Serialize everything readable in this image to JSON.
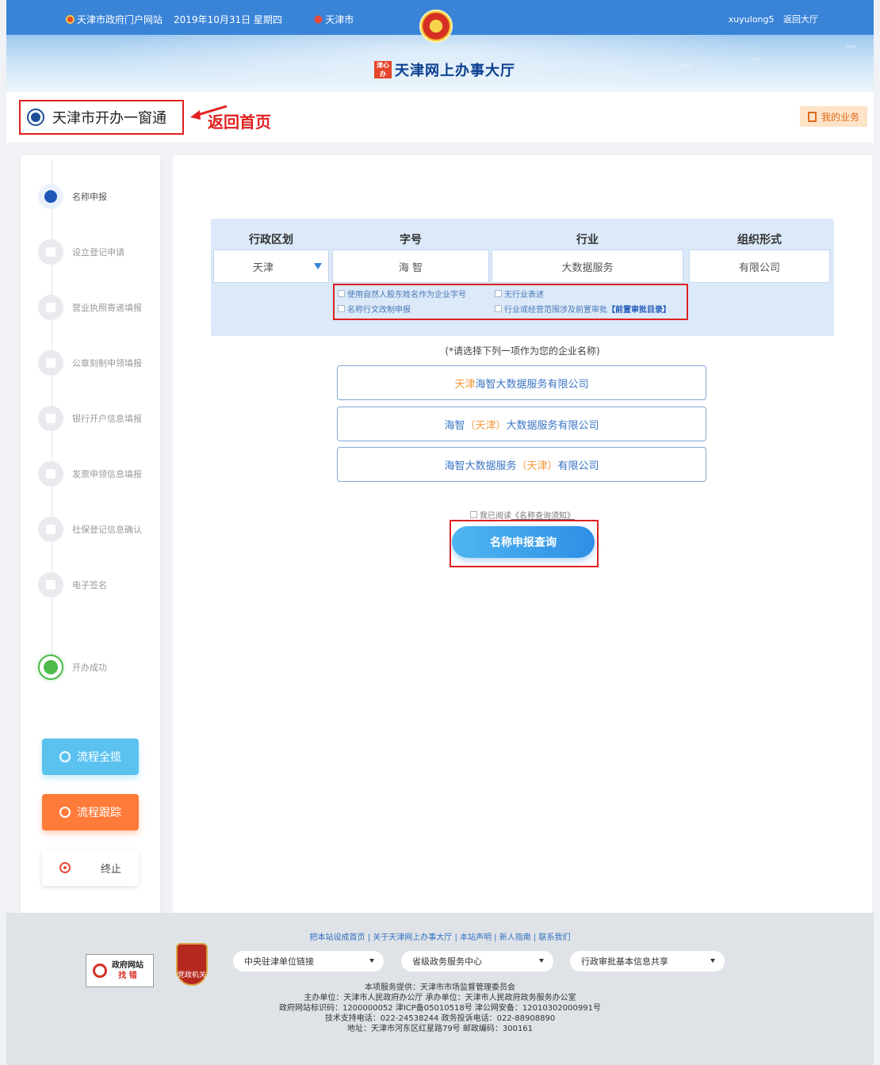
{
  "topbar": {
    "portal": "天津市政府门户网站",
    "date": "2019年10月31日 星期四",
    "city": "天津市",
    "user": "xuyulong5",
    "back_hall": "返回大厅"
  },
  "banner": {
    "logo": "津心办",
    "title": "天津网上办事大厅"
  },
  "header": {
    "service_title": "天津市开办一窗通",
    "annotation": "返回首页",
    "my_business": "我的业务"
  },
  "sidebar": {
    "steps": [
      {
        "label": "名称申报",
        "icon": "user-icon"
      },
      {
        "label": "设立登记申请",
        "icon": "building-icon"
      },
      {
        "label": "营业执照寄递填报",
        "icon": "license-icon"
      },
      {
        "label": "公章刻制申领填报",
        "icon": "stamp-icon"
      },
      {
        "label": "银行开户信息填报",
        "icon": "location-icon"
      },
      {
        "label": "发票申领信息填报",
        "icon": "invoice-icon"
      },
      {
        "label": "社保登记信息确认",
        "icon": "social-security-icon"
      },
      {
        "label": "电子签名",
        "icon": "pen-icon"
      },
      {
        "label": "开办成功",
        "icon": "check-icon"
      }
    ],
    "btn_overview": "流程全揽",
    "btn_tracking": "流程跟踪",
    "btn_terminate": "终止"
  },
  "form": {
    "headers": {
      "region": "行政区划",
      "brand": "字号",
      "industry": "行业",
      "org": "组织形式"
    },
    "values": {
      "region": "天津",
      "brand": "海 智",
      "industry": "大数据服务",
      "org": "有限公司"
    },
    "options": {
      "opt1": "使用自然人股东姓名作为企业字号",
      "opt2": "无行业表述",
      "opt3": "名称行文改制申报",
      "opt4": "行业或经营范围涉及前置审批",
      "opt4_link": "【前置审批目录】"
    }
  },
  "names": {
    "hint": "(*请选择下列一项作为您的企业名称)",
    "n1_hl": "天津",
    "n1_rest": "海智大数据服务有限公司",
    "n2_a": "海智",
    "n2_hl": "（天津）",
    "n2_b": "大数据服务有限公司",
    "n3_a": "海智大数据服务",
    "n3_hl": "（天津）",
    "n3_b": "有限公司"
  },
  "agree": {
    "prefix": "我已阅读",
    "link": "《名称查询须知》"
  },
  "query_button": "名称申报查询",
  "footer": {
    "links": "把本站设成首页 | 关于天津网上办事大厅 | 本站声明 | 新人指南 | 联系我们",
    "badge1_a": "政府网站",
    "badge1_b": "找 错",
    "badge2": "党政机关",
    "select1": "中央驻津单位链接",
    "select2": "省级政务服务中心",
    "select3": "行政审批基本信息共享",
    "line1": "本项服务提供：天津市市场监督管理委员会",
    "line2": "主办单位：天津市人民政府办公厅 承办单位：天津市人民政府政务服务办公室",
    "line3": "政府网站标识码：1200000052 津ICP备05010518号 津公网安备：12010302000991号",
    "line4": "技术支持电话：022-24538244 政务投诉电话：022-88908890",
    "line5": "地址：天津市河东区红星路79号 邮政编码：300161"
  },
  "colors": {
    "topbar": "#3a84d8",
    "accent_red": "#e02020",
    "highlight_orange": "#f39a3c",
    "button_blue": "#2f8ee6"
  }
}
